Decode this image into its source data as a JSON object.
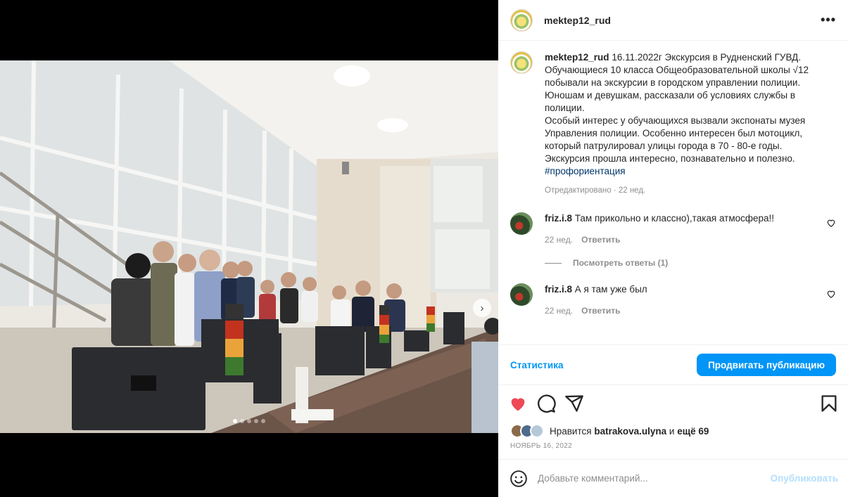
{
  "post": {
    "author": "mektep12_rud",
    "more_icon": "more-horizontal-icon",
    "caption_lines": [
      "16.11.2022г Экскурсия в Рудненский ГУВД.",
      "Обучающиеся 10 класса Общеобразовательной школы √12 побывали на экскурсии в городском управлении полиции. Юношам и девушкам, рассказали об условиях службы в полиции.",
      "Особый интерес у обучающихся вызвали экспонаты музея Управления полиции. Особенно интересен был мотоцикл, который патрулировал улицы города в 70 - 80-е годы.",
      "Экскурсия прошла интересно, познавательно и полезно."
    ],
    "hashtag": "#профориентация",
    "edited_meta": "Отредактировано · 22 нед."
  },
  "comments": [
    {
      "user": "friz.i.8",
      "text": "Там прикольно и классно),такая атмосфера!!",
      "time": "22 нед.",
      "reply": "Ответить",
      "view_replies": "Посмотреть ответы (1)"
    },
    {
      "user": "friz.i.8",
      "text": "А я там уже был",
      "time": "22 нед.",
      "reply": "Ответить"
    }
  ],
  "stats": {
    "link": "Статистика",
    "promote": "Продвигать публикацию"
  },
  "likes": {
    "prefix": "Нравится",
    "user": "batrakova.ulyna",
    "conj": "и",
    "rest": "ещё 69"
  },
  "date": "Ноябрь 16, 2022",
  "composer": {
    "placeholder": "Добавьте комментарий...",
    "post": "Опубликовать"
  },
  "carousel": {
    "count": 5,
    "active": 1
  },
  "colors": {
    "accent": "#0095f6",
    "like": "#ed4956"
  }
}
